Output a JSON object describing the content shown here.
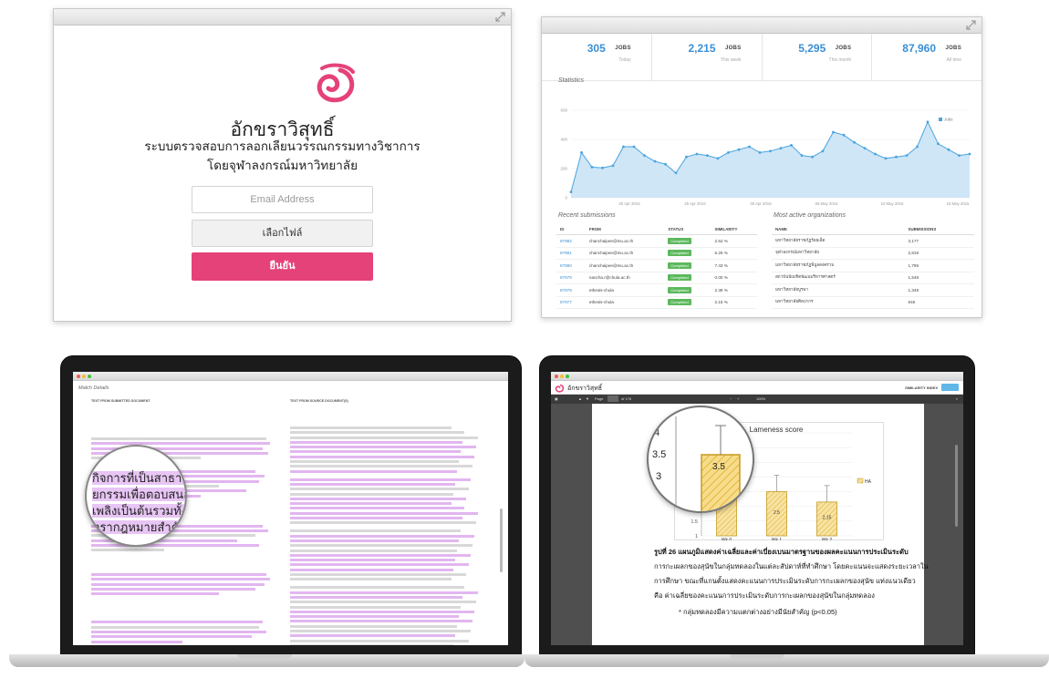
{
  "login": {
    "brand": "อักขราวิสุทธิ์",
    "subtitle_line1": "ระบบตรวจสอบการลอกเลียนวรรณกรรมทางวิชาการ",
    "subtitle_line2": "โดยจุฬาลงกรณ์มหาวิทยาลัย",
    "email_placeholder": "Email Address",
    "file_button": "เลือกไฟล์",
    "submit_button": "ยืนยัน",
    "accent": "#e5427a"
  },
  "dashboard": {
    "stats": [
      {
        "value": "305",
        "unit": "JOBS",
        "label": "Today"
      },
      {
        "value": "2,215",
        "unit": "JOBS",
        "label": "This week"
      },
      {
        "value": "5,295",
        "unit": "JOBS",
        "label": "This month"
      },
      {
        "value": "87,960",
        "unit": "JOBS",
        "label": "All time"
      }
    ],
    "statistics_title": "Statistics",
    "chart_data": {
      "type": "area",
      "x_tick_labels": [
        "20 Apr 2015",
        "25 Apr 2015",
        "30 Apr 2015",
        "05 May 2015",
        "10 May 2015",
        "15 May 2015"
      ],
      "y_tick_labels": [
        "0",
        "200",
        "400",
        "600"
      ],
      "ylim": [
        0,
        600
      ],
      "values": [
        40,
        310,
        210,
        205,
        220,
        350,
        350,
        290,
        250,
        230,
        170,
        280,
        300,
        290,
        270,
        310,
        330,
        350,
        310,
        320,
        340,
        360,
        290,
        280,
        320,
        450,
        430,
        380,
        340,
        300,
        270,
        280,
        290,
        350,
        520,
        370,
        330,
        290,
        300
      ],
      "legend": "Jobs",
      "color": "#4aa3df",
      "grid": true
    },
    "recent_title": "Recent submissions",
    "recent_headers": [
      "ID",
      "FROM",
      "STATUS",
      "SIMILARITY"
    ],
    "recent_rows": [
      [
        "87982",
        "chanchaipee@mu.ac.th",
        "Completed",
        "2.52 %"
      ],
      [
        "87981",
        "chanchaipee@mu.ac.th",
        "Completed",
        "6.25 %"
      ],
      [
        "87980",
        "chanchaipee@mu.ac.th",
        "Completed",
        "7.43 %"
      ],
      [
        "87979",
        "nancha.r@chula.ac.th",
        "Completed",
        "0.00 %"
      ],
      [
        "87978",
        "ethesis-chula",
        "Completed",
        "2.38 %"
      ],
      [
        "87977",
        "ethesis-chula",
        "Completed",
        "2.15 %"
      ]
    ],
    "orgs_title": "Most active organizations",
    "orgs_headers": [
      "NAME",
      "SUBMISSIONS"
    ],
    "orgs_rows": [
      [
        "มหาวิทยาลัยราชภัฏร้อยเอ็ด",
        "3,177"
      ],
      [
        "จุฬาลงกรณ์มหาวิทยาลัย",
        "2,818"
      ],
      [
        "มหาวิทยาลัยราชภัฏพิบูลสงคราม",
        "1,795"
      ],
      [
        "สถาบันบัณฑิตพัฒนบริหารศาสตร์",
        "1,548"
      ],
      [
        "มหาวิทยาลัยบูรพา",
        "1,349"
      ],
      [
        "มหาวิทยาลัยศิลปากร",
        "945"
      ]
    ]
  },
  "match": {
    "title": "Match Details",
    "col_left": "TEXT FROM SUBMITTED DOCUMENT",
    "col_right": "TEXT FROM SOURCE DOCUMENT(S)",
    "magnified_lines": [
      "กิจการที่เป็นสาธาร",
      "ยกรรมเพื่อตอบสนอง",
      "เพลิงเป็นต้นรวมทั้งแ",
      "ตรากฎหมายสำคัญ"
    ]
  },
  "report": {
    "app_name": "อักขราวิสุทธิ์",
    "similarity_index": "SIMILARITY INDEX",
    "toolbar_page": "Page",
    "toolbar_of": "of 176",
    "toolbar_zoom": "100%",
    "chart_data": {
      "type": "bar",
      "title": "Lameness score",
      "categories": [
        "Wk 0",
        "Wk 1",
        "Wk 2"
      ],
      "values": [
        3.5,
        2.5,
        2.15
      ],
      "value_labels": [
        "3.5",
        "2.5",
        "2.15"
      ],
      "ylim": [
        1,
        4.5
      ],
      "y_tick_labels": [
        "1",
        "1.5",
        "2",
        "2.5",
        "3",
        "3.5",
        "4",
        "4.5"
      ],
      "legend": "HA",
      "bar_color": "#f2d27a"
    },
    "magnifier_ticks": [
      "4",
      "3.5",
      "3"
    ],
    "magnifier_bar_label": "3.5",
    "caption_line1": "รูปที่ 26 แผนภูมิแสดงค่าเฉลี่ยและค่าเบี่ยงเบนมาตรฐานของผลคะแนนการประเมินระดับ",
    "caption_line2": "การกะเผลกของสุนัขในกลุ่มทดลองในแต่ละสัปดาห์ที่ทำศึกษา โดยคะแนนจะแสดงระยะเวลาใน",
    "caption_line3": "การศึกษา ขณะที่แกนตั้งแสดงคะแนนการประเมินระดับการกะเผลกของสุนัข แท่งแนวเดียว",
    "caption_line4": "คือ ค่าเฉลี่ยของคะแนนการประเมินระดับการกะเผลกของสุนัขในกลุ่มทดลอง",
    "caption_note": "* กลุ่มทดลองมีความแตกต่างอย่างมีนัยสำคัญ (p<0.05)"
  }
}
